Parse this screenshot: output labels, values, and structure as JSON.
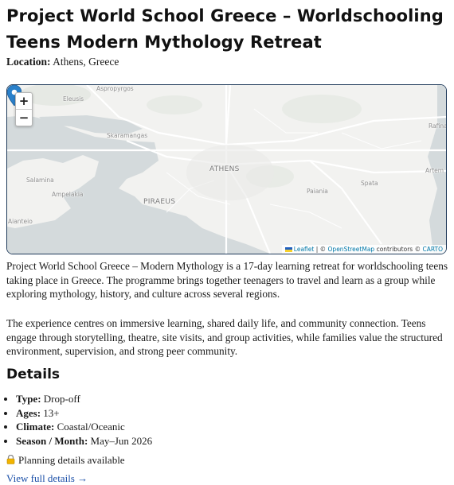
{
  "page": {
    "title": "Project World School Greece – Worldschooling Teens Modern Mythology Retreat",
    "location_label": "Location:",
    "location_value": "Athens, Greece"
  },
  "map": {
    "zoom_in": "+",
    "zoom_out": "−",
    "places": {
      "aspropyrgos": "Aspropyrgos",
      "eleusis": "Eleusis",
      "skaramangas": "Skaramangas",
      "salamina": "Salamina",
      "ampelakia": "Ampelakia",
      "piraeus": "PIRAEUS",
      "athens": "ATHENS",
      "paiania": "Paiania",
      "spata": "Spata",
      "rafina": "Rafina",
      "artemis": "Artem",
      "aianteio": "Aianteio"
    },
    "attribution": {
      "leaflet": "Leaflet",
      "sep": "|",
      "copyright_prefix": "©",
      "osm": "OpenStreetMap",
      "contributors": "contributors ©",
      "carto": "CARTO"
    },
    "colors": {
      "water": "#d4dadc",
      "land": "#f2f2f0",
      "marker": "#2a81cb"
    }
  },
  "description": {
    "p1": "Project World School Greece – Modern Mythology is a 17-day learning retreat for worldschooling teens taking place in Greece. The programme brings together teenagers to travel and learn as a group while exploring mythology, history, and culture across several regions.",
    "p2": "The experience centres on immersive learning, shared daily life, and community connection. Teens engage through storytelling, theatre, site visits, and group activities, while families value the structured environment, supervision, and strong peer community."
  },
  "details": {
    "heading": "Details",
    "items": [
      {
        "label": "Type:",
        "value": "Drop-off"
      },
      {
        "label": "Ages:",
        "value": "13+"
      },
      {
        "label": "Climate:",
        "value": "Coastal/Oceanic"
      },
      {
        "label": "Season / Month:",
        "value": "May–Jun 2026"
      }
    ],
    "planning": "Planning details available",
    "planning_icon": "lock-icon",
    "view_link": "View full details →"
  }
}
